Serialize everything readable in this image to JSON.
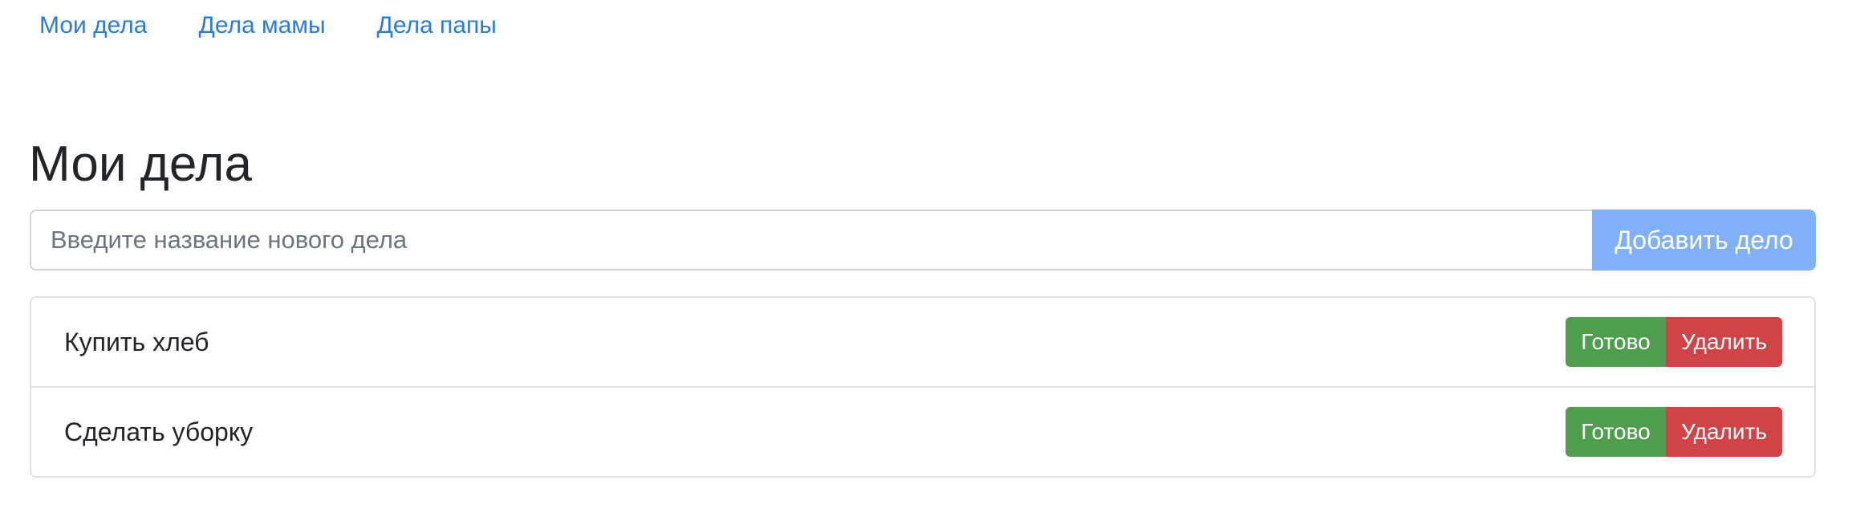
{
  "nav": {
    "links": [
      {
        "label": "Мои дела"
      },
      {
        "label": "Дела мамы"
      },
      {
        "label": "Дела папы"
      }
    ]
  },
  "page_title": "Мои дела",
  "add_form": {
    "placeholder": "Введите название нового дела",
    "value": "",
    "button_label": "Добавить дело"
  },
  "tasks": [
    {
      "text": "Купить хлеб",
      "done_label": "Готово",
      "delete_label": "Удалить"
    },
    {
      "text": "Сделать уборку",
      "done_label": "Готово",
      "delete_label": "Удалить"
    }
  ],
  "colors": {
    "link": "#2a7ae4",
    "add_button": "#7fb0f9",
    "done_button": "#4f9e4f",
    "delete_button": "#d04448",
    "text": "#212529"
  }
}
